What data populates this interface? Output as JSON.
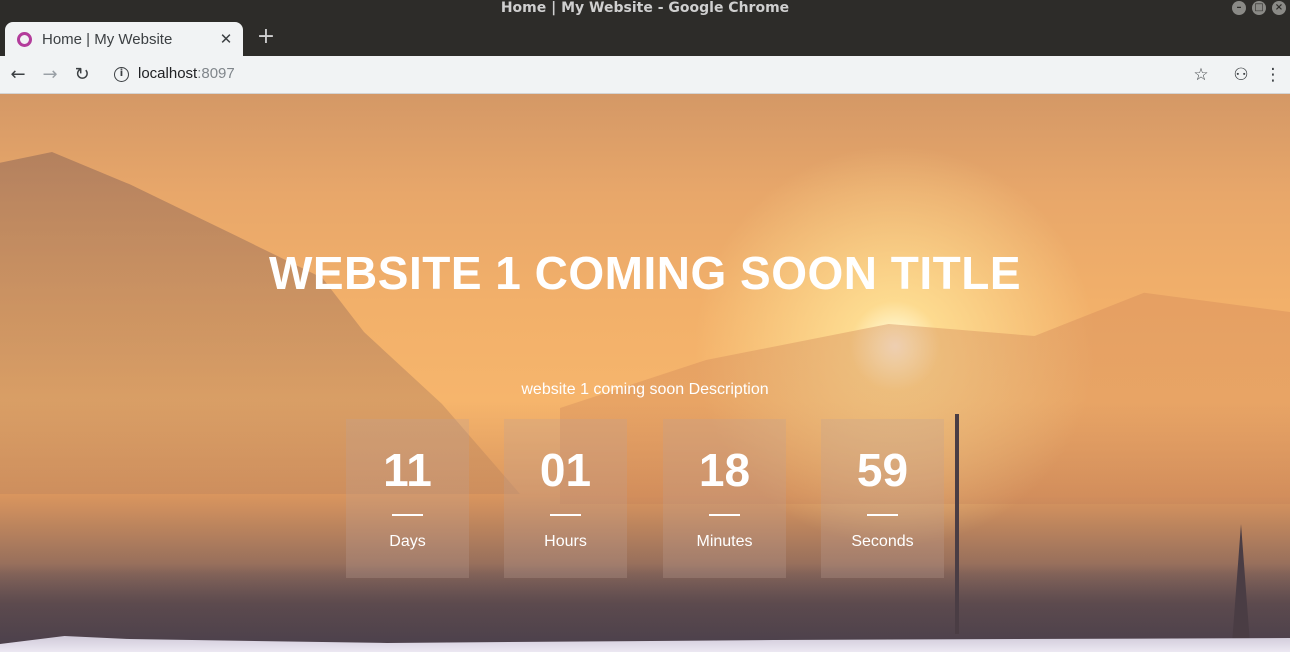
{
  "window": {
    "title": "Home | My Website - Google Chrome",
    "controls": [
      "minimize",
      "maximize",
      "close"
    ]
  },
  "tabs": [
    {
      "title": "Home | My Website",
      "favicon": "circle-logo-icon",
      "active": true
    }
  ],
  "toolbar": {
    "back_icon": "←",
    "forward_icon": "→",
    "reload_icon": "↻",
    "info_icon": "i",
    "url_host": "localhost",
    "url_port": ":8097",
    "bookmark_icon": "☆",
    "incognito_icon": "⚇",
    "menu_icon": "⋮",
    "new_tab_icon": "+",
    "close_tab_icon": "✕"
  },
  "page": {
    "title": "WEBSITE 1 COMING SOON TITLE",
    "description": "website 1 coming soon Description",
    "countdown": [
      {
        "value": "11",
        "label": "Days"
      },
      {
        "value": "01",
        "label": "Hours"
      },
      {
        "value": "18",
        "label": "Minutes"
      },
      {
        "value": "59",
        "label": "Seconds"
      }
    ]
  },
  "colors": {
    "accent_favicon": "#b33c9b",
    "tab_bg": "#f1f3f4",
    "titlebar_bg": "#2d2c29"
  }
}
